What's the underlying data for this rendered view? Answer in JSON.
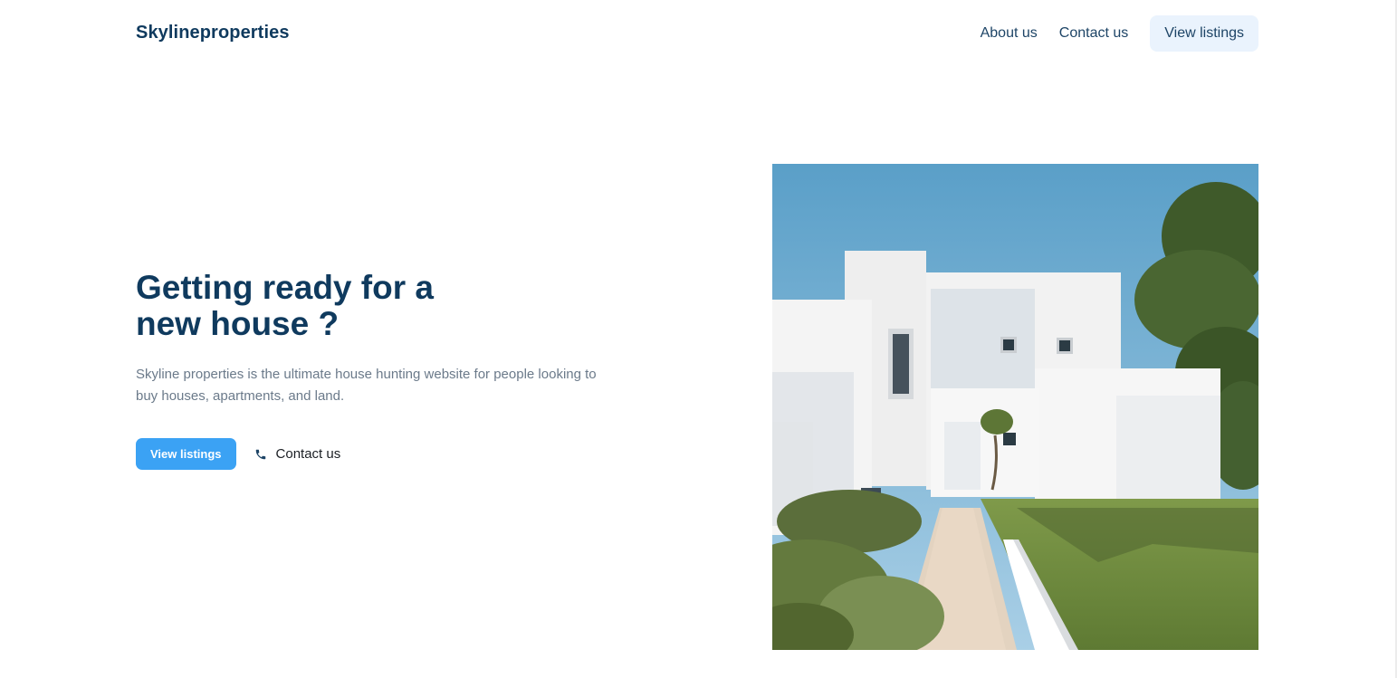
{
  "header": {
    "brand": "Skylineproperties",
    "nav": {
      "about": "About us",
      "contact": "Contact us",
      "cta": "View listings"
    }
  },
  "hero": {
    "title_line1": "Getting ready for a",
    "title_line2": "new house ?",
    "description": "Skyline properties is the ultimate house hunting website for people looking to buy houses, apartments, and land.",
    "primary_button": "View listings",
    "secondary_button": "Contact us",
    "secondary_icon": "phone-icon",
    "image_subject": "white-modern-house-photo"
  },
  "colors": {
    "brand": "#0f3a5e",
    "primary_button": "#3ba2f4",
    "nav_cta_bg": "#eaf3fd",
    "muted_text": "#6b7a8a"
  }
}
